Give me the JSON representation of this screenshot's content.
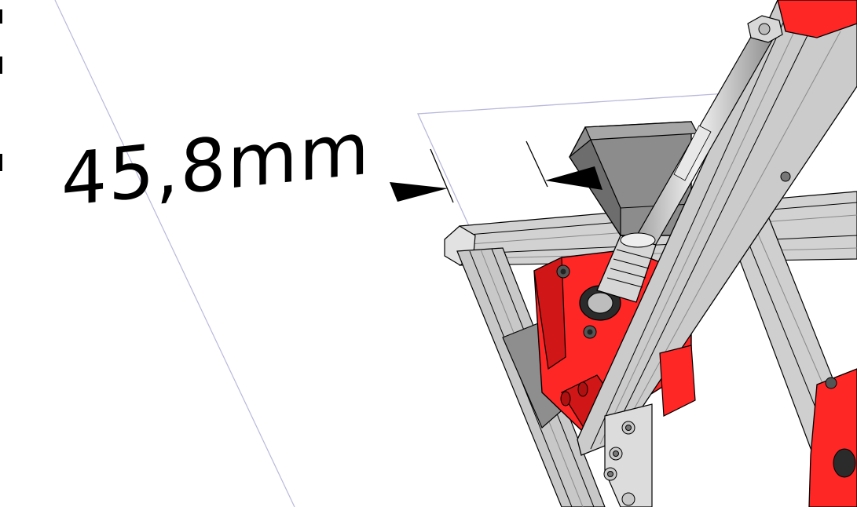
{
  "dimension": {
    "value_label": "45,8mm"
  },
  "colors": {
    "background": "#ffffff",
    "printed_part": "#ff2222",
    "printed_part_shade": "#c21414",
    "motor": "#8a8a8a",
    "motor_dark": "#5e5e5e",
    "aluminum": "#c9c9c9",
    "aluminum_dark": "#9a9a9a",
    "rod": "#bfbfbf",
    "guide_line": "#b8b8dc",
    "outline": "#000000"
  }
}
